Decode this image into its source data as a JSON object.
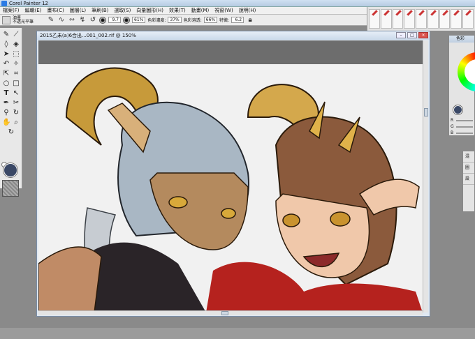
{
  "app": {
    "title": "Corel Painter 12"
  },
  "menu": {
    "items": [
      "檔案(F)",
      "編輯(E)",
      "畫布(C)",
      "圖層(L)",
      "筆刷(B)",
      "選取(S)",
      "向量圖形(H)",
      "效果(T)",
      "動畫(M)",
      "視窗(W)",
      "說明(H)"
    ]
  },
  "propbar": {
    "brush_category": "油畫",
    "brush_variant": "不透光平筆",
    "size_value": "9.7",
    "opacity_value": "61%",
    "resat_label": "色彩濃度:",
    "resat_value": "37%",
    "bleed_label": "色彩溶透:",
    "bleed_value": "66%",
    "feature_label": "特徵:",
    "feature_value": "6.2"
  },
  "document": {
    "title": "2015乙未(a)6合出...001_002.rif @ 150%"
  },
  "color_panel": {
    "title": "色彩",
    "slider_labels": [
      "R",
      "G",
      "B"
    ],
    "current_color": "#3a4866"
  },
  "layers_panel": {
    "items": [
      "混",
      "圖",
      "設"
    ]
  },
  "colors": {
    "main_color": "#3a4866",
    "canvas_gray": "#6d6d6d",
    "menu_bg": "#f0f0f0"
  },
  "toolbox": {
    "tools": [
      "brush-tool",
      "dropper-tool",
      "eraser-tool",
      "paint-bucket-tool",
      "selection-tool",
      "lasso-tool",
      "magic-wand-tool",
      "transform-tool",
      "crop-tool",
      "shape-tool",
      "text-tool",
      "pen-tool",
      "mirror-tool",
      "grabber-tool",
      "magnifier-tool",
      "rotate-page-tool"
    ]
  }
}
